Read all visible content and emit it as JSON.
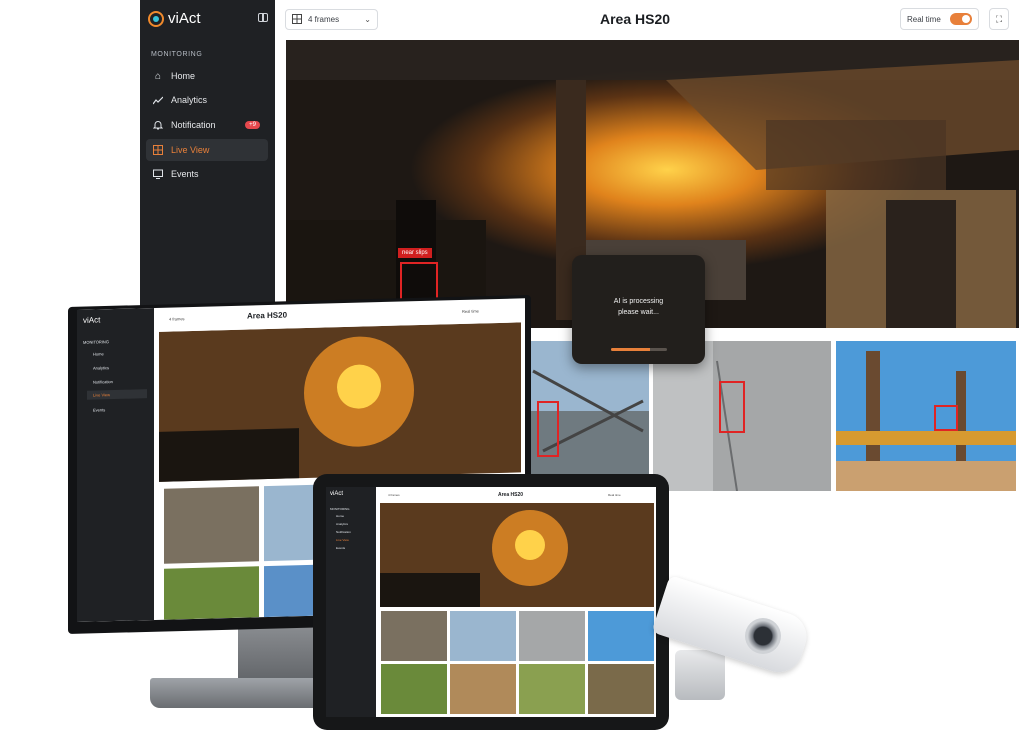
{
  "app": {
    "brand": "viAct",
    "section_label": "MONITORING",
    "nav": [
      {
        "label": "Home",
        "icon": "home-icon"
      },
      {
        "label": "Analytics",
        "icon": "analytics-icon"
      },
      {
        "label": "Notification",
        "icon": "bell-icon",
        "badge": "+9"
      },
      {
        "label": "Live View",
        "icon": "grid-icon",
        "active": true
      },
      {
        "label": "Events",
        "icon": "events-icon"
      }
    ],
    "frames_select": "4 frames",
    "title": "Area HS20",
    "realtime_label": "Real time",
    "realtime_on": true,
    "accent_color": "#e8803a"
  },
  "feed": {
    "detection_label": "near slips",
    "processing_line1": "AI is processing",
    "processing_line2": "please wait...",
    "processing_progress": 0.7
  }
}
